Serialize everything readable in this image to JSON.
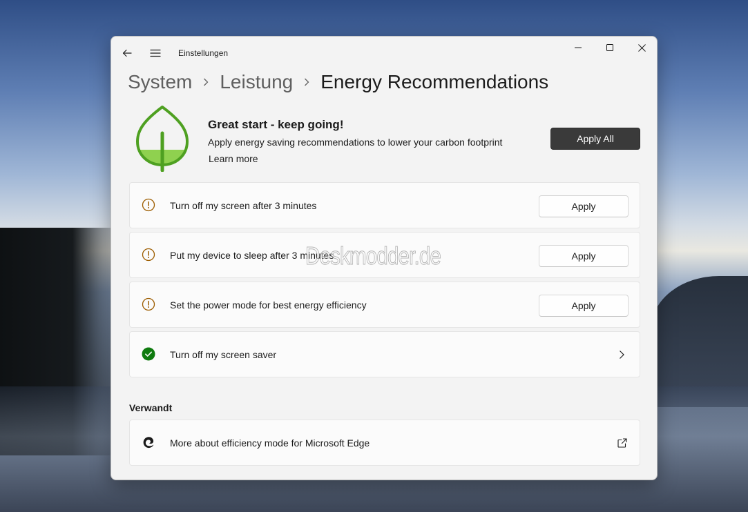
{
  "app": {
    "title": "Einstellungen"
  },
  "breadcrumb": {
    "items": [
      "System",
      "Leistung"
    ],
    "current": "Energy Recommendations"
  },
  "hero": {
    "title": "Great start - keep going!",
    "subtitle": "Apply energy saving recommendations to lower your carbon footprint",
    "link": "Learn more",
    "apply_all": "Apply All",
    "leaf_color": "#4ea021"
  },
  "recommendations": [
    {
      "label": "Turn off my screen after 3 minutes",
      "status": "warning",
      "action": "Apply"
    },
    {
      "label": "Put my device to sleep after 3 minutes",
      "status": "warning",
      "action": "Apply"
    },
    {
      "label": "Set the power mode for best energy efficiency",
      "status": "warning",
      "action": "Apply"
    },
    {
      "label": "Turn off my screen saver",
      "status": "done",
      "action": ""
    }
  ],
  "related": {
    "title": "Verwandt",
    "items": [
      {
        "label": "More about efficiency mode for Microsoft Edge",
        "icon": "edge-icon"
      }
    ]
  },
  "colors": {
    "warning": "#9d5d00",
    "success": "#0f7b0f"
  },
  "watermark": "Deskmodder.de"
}
